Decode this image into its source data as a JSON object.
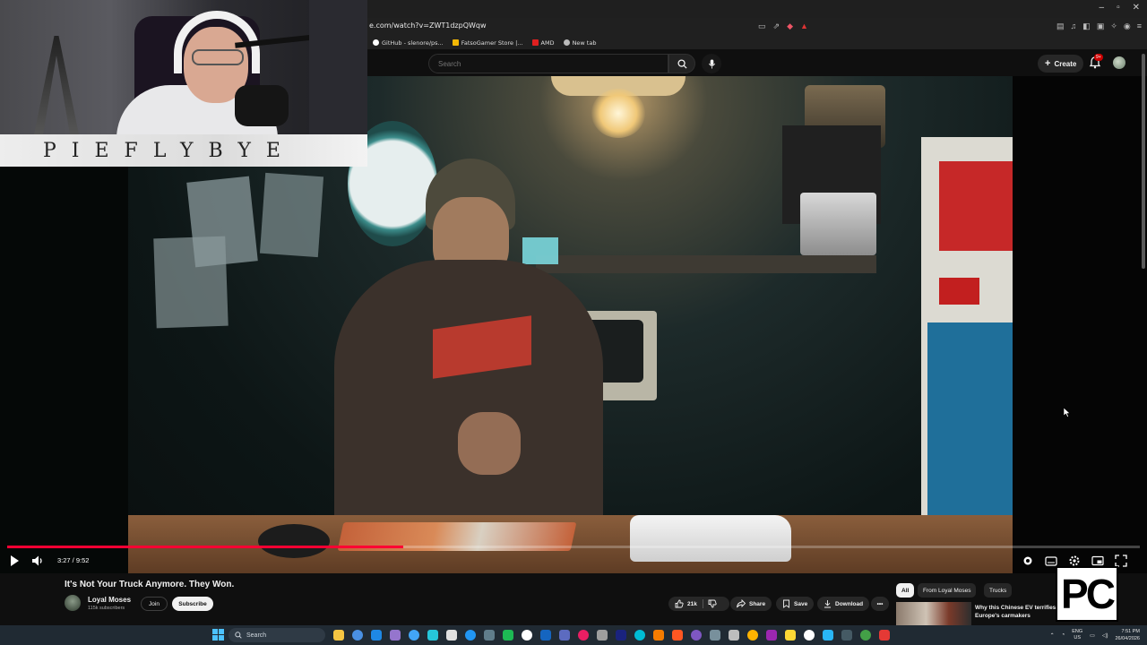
{
  "browser": {
    "url": "e.com/watch?v=ZWT1dzpQWqw",
    "bookmarks": [
      {
        "label": "GitHub - slenore/ps...",
        "color": "#ffffff"
      },
      {
        "label": "FatsoGamer Store |...",
        "color": "#f2b705"
      },
      {
        "label": "AMD",
        "color": "#e02020"
      },
      {
        "label": "New tab",
        "color": "#bbbbbb"
      }
    ]
  },
  "youtube": {
    "search_placeholder": "Search",
    "create_label": "Create",
    "notification_count": "9+"
  },
  "overlay": {
    "streamer_name": "PIEFLYBYE"
  },
  "player": {
    "time": "3:27 / 9:52",
    "progress": 0.35
  },
  "video": {
    "title": "It's Not Your Truck Anymore. They Won.",
    "channel_name": "Loyal Moses",
    "subscribers": "115k subscribers",
    "join_label": "Join",
    "subscribe_label": "Subscribe",
    "likes": "21k",
    "share_label": "Share",
    "save_label": "Save",
    "download_label": "Download"
  },
  "sidebar": {
    "chips": [
      "All",
      "From Loyal Moses",
      "Trucks"
    ],
    "recommendation_title": "Why this Chinese EV terrifies Europe's carmakers"
  },
  "stream_logo": "PC",
  "taskbar": {
    "search_label": "Search",
    "language": "ENG",
    "region": "US",
    "time": "7:51 PM",
    "date": "26/04/2026",
    "app_colors": [
      "#f5c542",
      "#4a90e2",
      "#1e88e5",
      "#9575cd",
      "#42a5f5",
      "#26c6da",
      "#e0e0e0",
      "#2196f3",
      "#607d8b",
      "#1db954",
      "#ffffff",
      "#1565c0",
      "#5c6bc0",
      "#e91e63",
      "#9e9e9e",
      "#1a237e",
      "#00bcd4",
      "#f57c00",
      "#ff5722",
      "#7e57c2",
      "#78909c",
      "#bdbdbd",
      "#ffb300",
      "#9c27b0",
      "#fdd835",
      "#ffffff",
      "#29b6f6",
      "#455a64",
      "#43a047",
      "#e53935"
    ]
  }
}
